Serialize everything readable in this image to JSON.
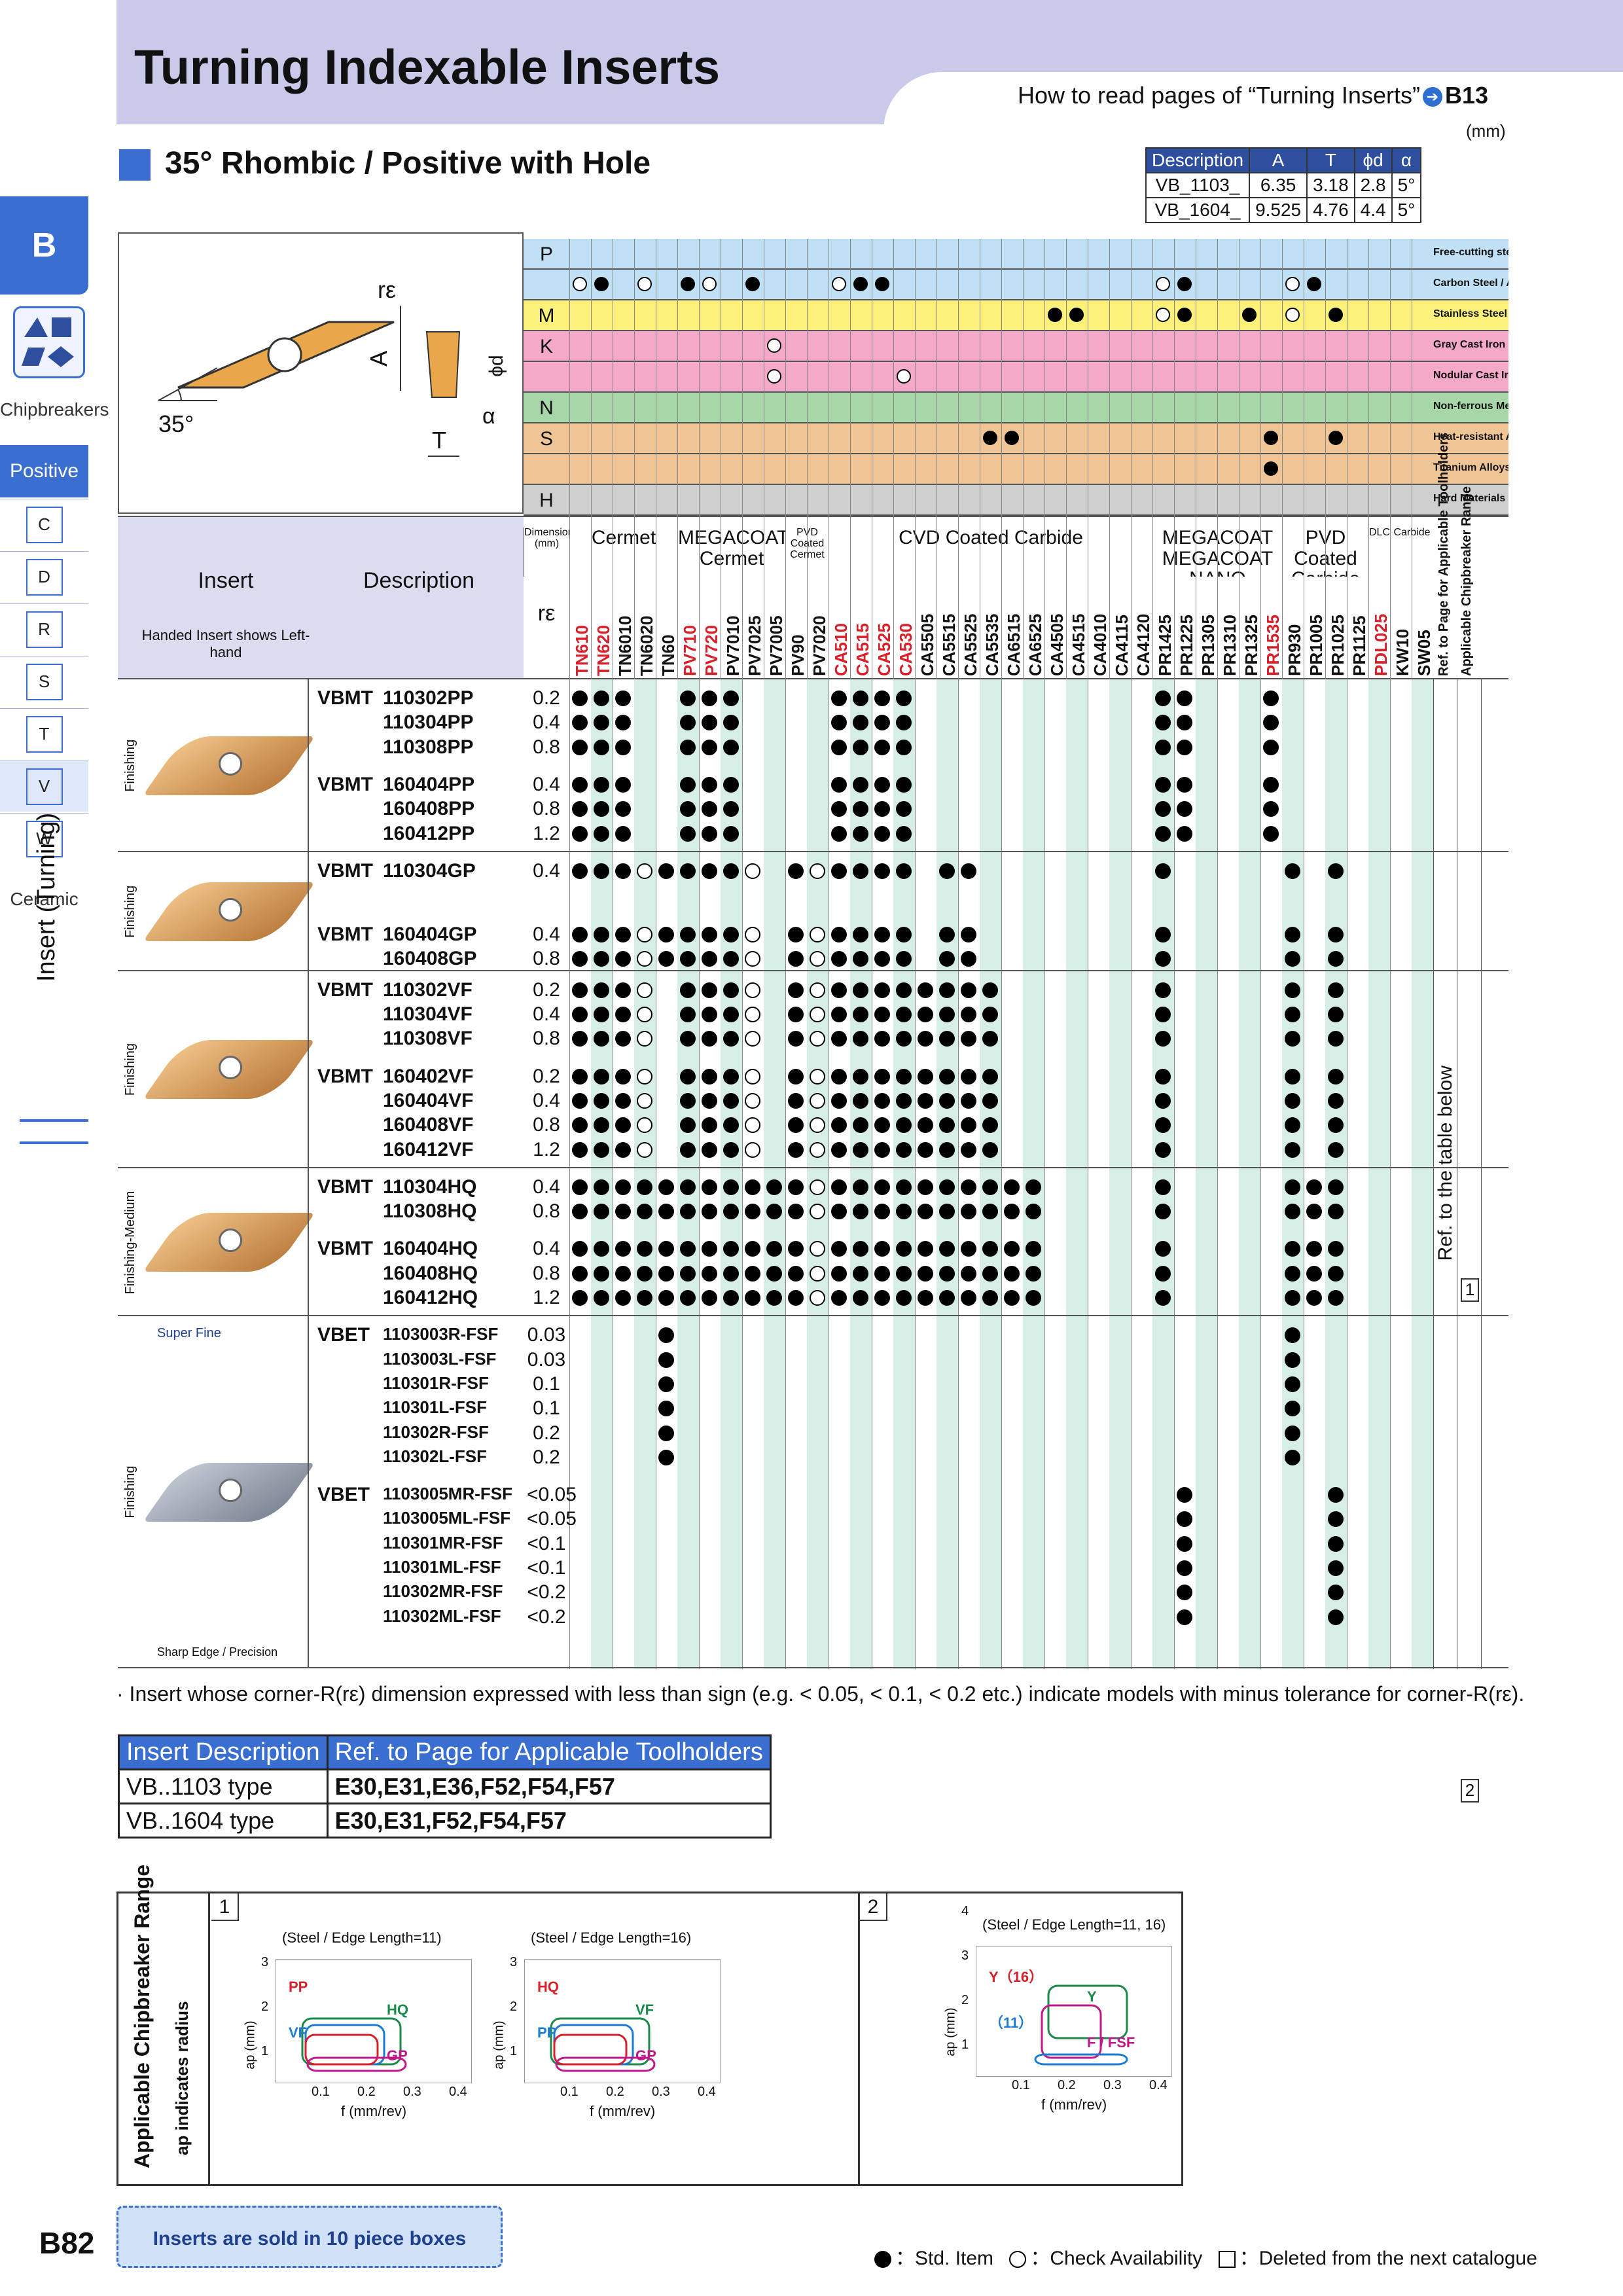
{
  "page": {
    "title": "Turning Indexable Inserts",
    "howto_text": "How to read pages of “Turning Inserts”",
    "howto_ref": "B13",
    "subheading": "35° Rhombic / Positive with Hole",
    "page_number": "B82",
    "unit": "(mm)"
  },
  "sidebar": {
    "section": "B",
    "chipbreakers": "Chipbreakers",
    "positive": "Positive",
    "shapes": [
      "C",
      "D",
      "R",
      "S",
      "T",
      "V",
      "W"
    ],
    "ceramic": "Ceramic",
    "vertical_label": "Insert (Turning)"
  },
  "dimensions": {
    "headers": [
      "Description",
      "A",
      "T",
      "ϕd",
      "α"
    ],
    "rows": [
      [
        "VB_1103_",
        "6.35",
        "3.18",
        "2.8",
        "5°"
      ],
      [
        "VB_1604_",
        "9.525",
        "4.76",
        "4.4",
        "5°"
      ]
    ]
  },
  "diagram": {
    "re": "rε",
    "a": "A",
    "phid": "ϕd",
    "alpha": "α",
    "angle": "35°",
    "t": "T"
  },
  "materials": [
    {
      "code": "P",
      "label": "Free-cutting steel",
      "color": "#bfe0f5"
    },
    {
      "code": "",
      "label": "Carbon Steel / Alloy Steel",
      "color": "#bfe0f5"
    },
    {
      "code": "M",
      "label": "Stainless Steel",
      "color": "#fbf17a"
    },
    {
      "code": "K",
      "label": "Gray Cast Iron",
      "color": "#f4a9c8"
    },
    {
      "code": "",
      "label": "Nodular Cast Iron",
      "color": "#f4a9c8"
    },
    {
      "code": "N",
      "label": "Non-ferrous Metals",
      "color": "#a7d7a8"
    },
    {
      "code": "S",
      "label": "Heat-resistant Alloys",
      "color": "#f0c596"
    },
    {
      "code": "",
      "label": "Titanium Alloys",
      "color": "#f0c596"
    },
    {
      "code": "H",
      "label": "Hard Materials",
      "color": "#cfcfcf"
    }
  ],
  "groups": [
    {
      "label": "Dimension (mm)"
    },
    {
      "label": "Cermet"
    },
    {
      "label": "MEGACOAT Cermet"
    },
    {
      "label": "PVD Coated Cermet"
    },
    {
      "label": "CVD Coated Carbide"
    },
    {
      "label": "MEGACOAT MEGACOAT NANO"
    },
    {
      "label": "PVD Coated Carbide"
    },
    {
      "label": "DLC"
    },
    {
      "label": "Carbide"
    },
    {
      "label": "Ref. to Page for Applicable Toolholders"
    },
    {
      "label": "Applicable Chipbreaker Range"
    }
  ],
  "grades": [
    "TN610",
    "TN620",
    "TN6010",
    "TN6020",
    "TN60",
    "PV710",
    "PV720",
    "PV7010",
    "PV7025",
    "PV7005",
    "PV90",
    "PV7020",
    "CA510",
    "CA515",
    "CA525",
    "CA530",
    "CA5505",
    "CA5515",
    "CA5525",
    "CA5535",
    "CA6515",
    "CA6525",
    "CA4505",
    "CA4515",
    "CA4010",
    "CA4115",
    "CA4120",
    "PR1425",
    "PR1225",
    "PR1305",
    "PR1310",
    "PR1325",
    "PR1535",
    "PR930",
    "PR1005",
    "PR1025",
    "PR1125",
    "PDL025",
    "KW10",
    "SW05"
  ],
  "grade_red": [
    "TN610",
    "TN620",
    "PV710",
    "PV720",
    "CA510",
    "CA515",
    "CA525",
    "CA530",
    "PR1535",
    "PDL025"
  ],
  "table_labels": {
    "insert": "Insert",
    "description": "Description",
    "handed": "Handed Insert shows Left-hand",
    "re": "rε",
    "ref_table": "Ref. to the table below",
    "ref1": "1",
    "ref2": "2"
  },
  "sections": [
    {
      "label": "Finishing",
      "rows": [
        {
          "prefix": "VBMT",
          "code": "110302PP",
          "re": "0.2"
        },
        {
          "prefix": "",
          "code": "110304PP",
          "re": "0.4"
        },
        {
          "prefix": "",
          "code": "110308PP",
          "re": "0.8"
        },
        {
          "prefix": "VBMT",
          "code": "160404PP",
          "re": "0.4"
        },
        {
          "prefix": "",
          "code": "160408PP",
          "re": "0.8"
        },
        {
          "prefix": "",
          "code": "160412PP",
          "re": "1.2"
        }
      ]
    },
    {
      "label": "Finishing",
      "rows": [
        {
          "prefix": "VBMT",
          "code": "110304GP",
          "re": "0.4"
        },
        {
          "prefix": "VBMT",
          "code": "160404GP",
          "re": "0.4"
        },
        {
          "prefix": "",
          "code": "160408GP",
          "re": "0.8"
        }
      ]
    },
    {
      "label": "Finishing",
      "rows": [
        {
          "prefix": "VBMT",
          "code": "110302VF",
          "re": "0.2"
        },
        {
          "prefix": "",
          "code": "110304VF",
          "re": "0.4"
        },
        {
          "prefix": "",
          "code": "110308VF",
          "re": "0.8"
        },
        {
          "prefix": "VBMT",
          "code": "160402VF",
          "re": "0.2"
        },
        {
          "prefix": "",
          "code": "160404VF",
          "re": "0.4"
        },
        {
          "prefix": "",
          "code": "160408VF",
          "re": "0.8"
        },
        {
          "prefix": "",
          "code": "160412VF",
          "re": "1.2"
        }
      ]
    },
    {
      "label": "Finishing-Medium",
      "rows": [
        {
          "prefix": "VBMT",
          "code": "110304HQ",
          "re": "0.4"
        },
        {
          "prefix": "",
          "code": "110308HQ",
          "re": "0.8"
        },
        {
          "prefix": "VBMT",
          "code": "160404HQ",
          "re": "0.4"
        },
        {
          "prefix": "",
          "code": "160408HQ",
          "re": "0.8"
        },
        {
          "prefix": "",
          "code": "160412HQ",
          "re": "1.2"
        }
      ]
    },
    {
      "label": "Finishing",
      "sub_top": "Super Fine",
      "sub_bottom": "Sharp Edge / Precision",
      "rows": [
        {
          "prefix": "VBET",
          "code": "1103003R-FSF",
          "re": "0.03"
        },
        {
          "prefix": "",
          "code": "1103003L-FSF",
          "re": "0.03"
        },
        {
          "prefix": "",
          "code": "110301R-FSF",
          "re": "0.1"
        },
        {
          "prefix": "",
          "code": "110301L-FSF",
          "re": "0.1"
        },
        {
          "prefix": "",
          "code": "110302R-FSF",
          "re": "0.2"
        },
        {
          "prefix": "",
          "code": "110302L-FSF",
          "re": "0.2"
        },
        {
          "prefix": "VBET",
          "code": "1103005MR-FSF",
          "re": "<0.05"
        },
        {
          "prefix": "",
          "code": "1103005ML-FSF",
          "re": "<0.05"
        },
        {
          "prefix": "",
          "code": "110301MR-FSF",
          "re": "<0.1"
        },
        {
          "prefix": "",
          "code": "110301ML-FSF",
          "re": "<0.1"
        },
        {
          "prefix": "",
          "code": "110302MR-FSF",
          "re": "<0.2"
        },
        {
          "prefix": "",
          "code": "110302ML-FSF",
          "re": "<0.2"
        }
      ]
    }
  ],
  "note": "· Insert whose corner-R(rε) dimension expressed with less than sign (e.g. < 0.05, < 0.1, < 0.2 etc.) indicate models with minus tolerance for corner-R(rε).",
  "toolholders": {
    "headers": [
      "Insert Description",
      "Ref. to Page for Applicable Toolholders"
    ],
    "rows": [
      [
        "VB..1103 type",
        "E30,E31,E36,F52,F54,F57"
      ],
      [
        "VB..1604 type",
        "E30,E31,F52,F54,F57"
      ]
    ]
  },
  "chipbreaker_box": {
    "title": "Applicable Chipbreaker Range",
    "subtitle": "ap indicates radius",
    "panel1": "1",
    "panel2": "2",
    "charts": [
      {
        "title": "(Steel / Edge Length=11)",
        "xlabel": "f (mm/rev)",
        "ylabel": "ap (mm)",
        "xticks": [
          "0.1",
          "0.2",
          "0.3",
          "0.4"
        ],
        "yticks": [
          "1",
          "2",
          "3"
        ],
        "labels": [
          "PP",
          "HQ",
          "VF",
          "GP"
        ]
      },
      {
        "title": "(Steel / Edge Length=16)",
        "xlabel": "f (mm/rev)",
        "ylabel": "ap (mm)",
        "xticks": [
          "0.1",
          "0.2",
          "0.3",
          "0.4"
        ],
        "yticks": [
          "1",
          "2",
          "3"
        ],
        "labels": [
          "HQ",
          "VF",
          "PP",
          "GP"
        ]
      },
      {
        "title": "(Steel / Edge Length=11, 16)",
        "xlabel": "f (mm/rev)",
        "ylabel": "ap (mm)",
        "xticks": [
          "0.1",
          "0.2",
          "0.3",
          "0.4"
        ],
        "yticks": [
          "1",
          "2",
          "3",
          "4"
        ],
        "labels": [
          "Y（16）",
          "Y",
          "（11）",
          "F / FSF"
        ]
      }
    ]
  },
  "footer": {
    "sold": "Inserts are sold in 10 piece boxes",
    "std": "：Std. Item",
    "check": "：Check Availability",
    "deleted": "：Deleted from the next catalogue"
  },
  "colors": {
    "accent": "#3a6fd1",
    "header_band": "#c9c9ea"
  }
}
